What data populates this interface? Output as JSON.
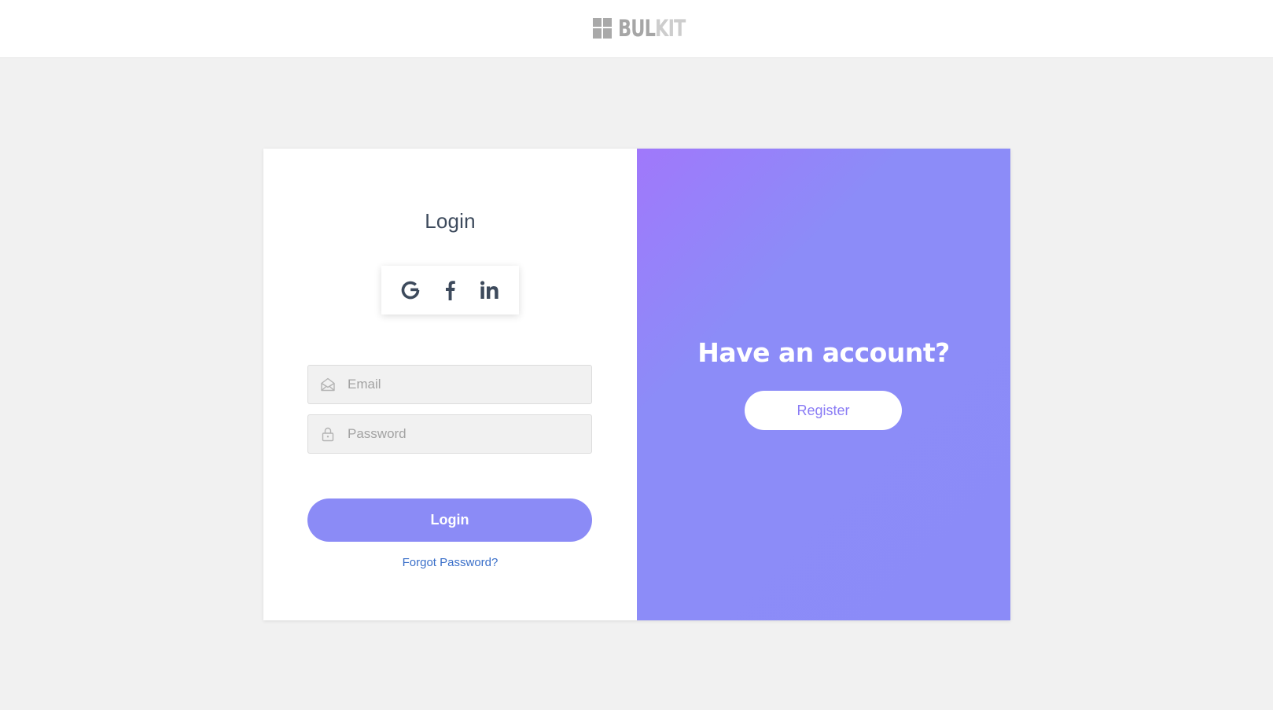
{
  "header": {
    "logo_part1": "BUL",
    "logo_part2": "KIT"
  },
  "login": {
    "title": "Login",
    "social": [
      "google-icon",
      "facebook-icon",
      "linkedin-icon"
    ],
    "email_placeholder": "Email",
    "password_placeholder": "Password",
    "submit_label": "Login",
    "forgot_label": "Forgot Password?"
  },
  "register_panel": {
    "heading": "Have an account?",
    "button_label": "Register"
  },
  "colors": {
    "accent": "#8b8bf6",
    "gradient_start": "#a078fb",
    "heading": "#3d4a5c",
    "link": "#3a6fc9"
  }
}
